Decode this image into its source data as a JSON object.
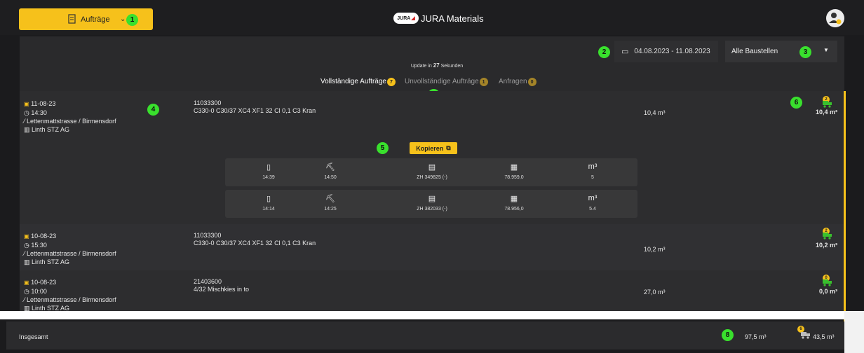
{
  "header": {
    "orders_button": "Aufträge",
    "brand_logo": "JURA",
    "brand_name": "JURA Materials"
  },
  "filters": {
    "date_range": "04.08.2023 - 11.08.2023",
    "site_select": "Alle Baustellen"
  },
  "update": {
    "prefix": "Update in",
    "seconds": "27",
    "suffix": "Sekunden"
  },
  "tabs": [
    {
      "label": "Vollständige Aufträge",
      "count": "7"
    },
    {
      "label": "Unvollständige Aufträge",
      "count": "1"
    },
    {
      "label": "Anfragen",
      "count": "0"
    }
  ],
  "annotations": [
    "1",
    "2",
    "3",
    "4",
    "5",
    "6",
    "7",
    "8"
  ],
  "copy_button": "Kopieren",
  "orders": [
    {
      "date": "11-08-23",
      "time": "14:30",
      "site": "Lettenmattstrasse / Birmensdorf",
      "company": "Linth STZ AG",
      "code": "11033300",
      "product": "C330-0 C30/37 XC4 XF1 32 Cl 0,1 C3 Kran",
      "volume": "10,4 m³",
      "trucks": "2",
      "delivered": "10,4 m³"
    },
    {
      "date": "10-08-23",
      "time": "15:30",
      "site": "Lettenmattstrasse / Birmensdorf",
      "company": "Linth STZ AG",
      "code": "11033300",
      "product": "C330-0 C30/37 XC4 XF1 32 Cl 0,1 C3 Kran",
      "volume": "10,2 m³",
      "trucks": "2",
      "delivered": "10,2 m³"
    },
    {
      "date": "10-08-23",
      "time": "10:00",
      "site": "Lettenmattstrasse / Birmensdorf",
      "company": "Linth STZ AG",
      "code": "21403600",
      "product": "4/32 Mischkies in to",
      "volume": "27,0 m³",
      "trucks": "0",
      "delivered": "0,0 m³"
    }
  ],
  "deliveries": [
    {
      "loaded": "14:39",
      "arrived": "14:50",
      "truck": "ZH 349825 (-)",
      "ticket": "78.959,0",
      "m3": "5"
    },
    {
      "loaded": "14:14",
      "arrived": "14:25",
      "truck": "ZH 382033 (-)",
      "ticket": "78.956,0",
      "m3": "5.4"
    }
  ],
  "delivery_unit": "m³",
  "footer": {
    "label": "Insgesamt",
    "total_volume": "97,5 m³",
    "trucks": "6",
    "delivered": "43,5 m³"
  },
  "colors": {
    "accent": "#f6c11b",
    "annotation": "#39e02d",
    "background": "#1b1b1d"
  }
}
